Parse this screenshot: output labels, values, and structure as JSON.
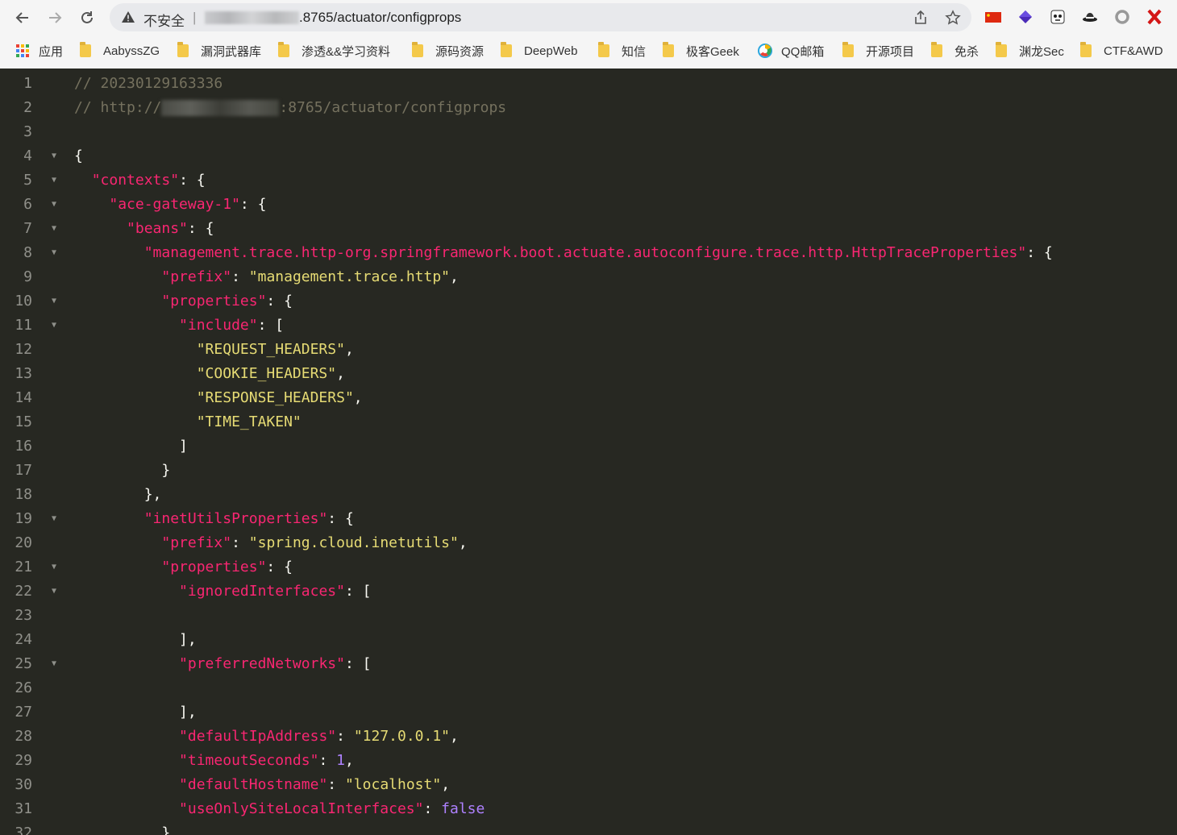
{
  "browser": {
    "insecure_label": "不安全",
    "separator": "|",
    "url_suffix": ".8765/actuator/configprops",
    "icons": [
      "back-icon",
      "forward-icon",
      "reload-icon",
      "warning-icon",
      "share-icon",
      "star-icon",
      "china-flag-icon",
      "extension-diamond-icon",
      "extension-panda-icon",
      "extension-hat-icon",
      "extension-ring-icon",
      "extension-x-icon"
    ]
  },
  "bookmarks": [
    {
      "label": "应用",
      "icon": "apps-grid-icon"
    },
    {
      "label": "AabyssZG",
      "icon": "folder-icon"
    },
    {
      "label": "漏洞武器库",
      "icon": "folder-icon"
    },
    {
      "label": "渗透&&学习资料",
      "icon": "folder-icon"
    },
    {
      "label": "源码资源",
      "icon": "folder-icon"
    },
    {
      "label": "DeepWeb",
      "icon": "folder-icon"
    },
    {
      "label": "知信",
      "icon": "folder-icon"
    },
    {
      "label": "极客Geek",
      "icon": "folder-icon"
    },
    {
      "label": "QQ邮箱",
      "icon": "qqmail-icon"
    },
    {
      "label": "开源项目",
      "icon": "folder-icon"
    },
    {
      "label": "免杀",
      "icon": "folder-icon"
    },
    {
      "label": "渊龙Sec",
      "icon": "folder-icon"
    },
    {
      "label": "CTF&AWD",
      "icon": "folder-icon"
    }
  ],
  "code": {
    "line_numbers": [
      "1",
      "2",
      "3",
      "4",
      "5",
      "6",
      "7",
      "8",
      "9",
      "10",
      "11",
      "12",
      "13",
      "14",
      "15",
      "16",
      "17",
      "18",
      "19",
      "20",
      "21",
      "22",
      "23",
      "24",
      "25",
      "26",
      "27",
      "28",
      "29",
      "30",
      "31",
      "32"
    ],
    "comment_timestamp": "// 20230129163336",
    "comment_url_prefix": "// http://",
    "comment_url_suffix": ":8765/actuator/configprops",
    "keys": {
      "contexts": "\"contexts\"",
      "gateway": "\"ace-gateway-1\"",
      "beans": "\"beans\"",
      "trace_bean": "\"management.trace.http-org.springframework.boot.actuate.autoconfigure.trace.http.HttpTraceProperties\"",
      "prefix": "\"prefix\"",
      "properties": "\"properties\"",
      "include": "\"include\"",
      "inet_bean": "\"inetUtilsProperties\"",
      "ignored": "\"ignoredInterfaces\"",
      "preferred": "\"preferredNetworks\"",
      "default_ip": "\"defaultIpAddress\"",
      "timeout": "\"timeoutSeconds\"",
      "default_host": "\"defaultHostname\"",
      "use_only": "\"useOnlySiteLocalInterfaces\""
    },
    "values": {
      "trace_prefix": "\"management.trace.http\"",
      "inet_prefix": "\"spring.cloud.inetutils\"",
      "include_items": [
        "\"REQUEST_HEADERS\"",
        "\"COOKIE_HEADERS\"",
        "\"RESPONSE_HEADERS\"",
        "\"TIME_TAKEN\""
      ],
      "default_ip": "\"127.0.0.1\"",
      "timeout": "1",
      "default_host": "\"localhost\"",
      "use_only": "false"
    }
  }
}
